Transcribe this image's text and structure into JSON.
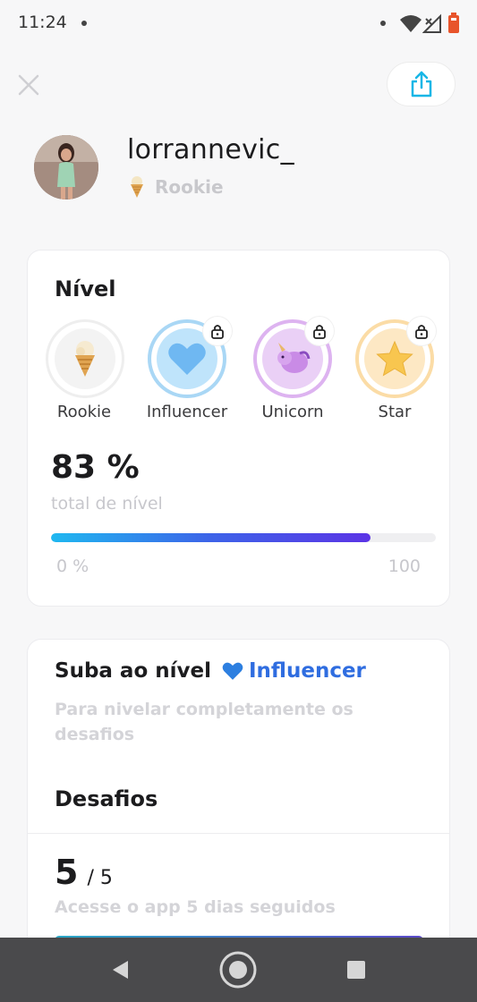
{
  "status": {
    "time": "11:24"
  },
  "profile": {
    "username": "lorrannevic_",
    "rank": "Rookie",
    "rank_icon": "ice-cream-icon"
  },
  "level_card": {
    "title": "Nível",
    "badges": [
      {
        "label": "Rookie",
        "icon": "ice-cream-icon",
        "locked": false,
        "color": "#f1f1f1"
      },
      {
        "label": "Influencer",
        "icon": "blue-heart-icon",
        "locked": true,
        "color": "#a9d7f5"
      },
      {
        "label": "Unicorn",
        "icon": "unicorn-icon",
        "locked": true,
        "color": "#ddb3f0"
      },
      {
        "label": "Star",
        "icon": "star-icon",
        "locked": true,
        "color": "#fbdca6"
      }
    ],
    "percent_text": "83 %",
    "percent_value": 0.83,
    "percent_label": "total de nível",
    "range_min": "0 %",
    "range_max": "100"
  },
  "challenges_card": {
    "level_up_label": "Suba ao nível",
    "level_up_target": "Influencer",
    "level_up_icon": "blue-heart-icon",
    "description": "Para nivelar completamente os desafios",
    "section_title": "Desafios",
    "challenge": {
      "count": "5",
      "total": "/ 5",
      "description": "Acesse o app 5 dias seguidos"
    }
  },
  "colors": {
    "accent_blue": "#2f6de0",
    "progress_start": "#1fb8f0",
    "progress_end": "#5b34e6",
    "share_icon": "#17b6e6",
    "nav_bar": "#4a4a4c"
  }
}
